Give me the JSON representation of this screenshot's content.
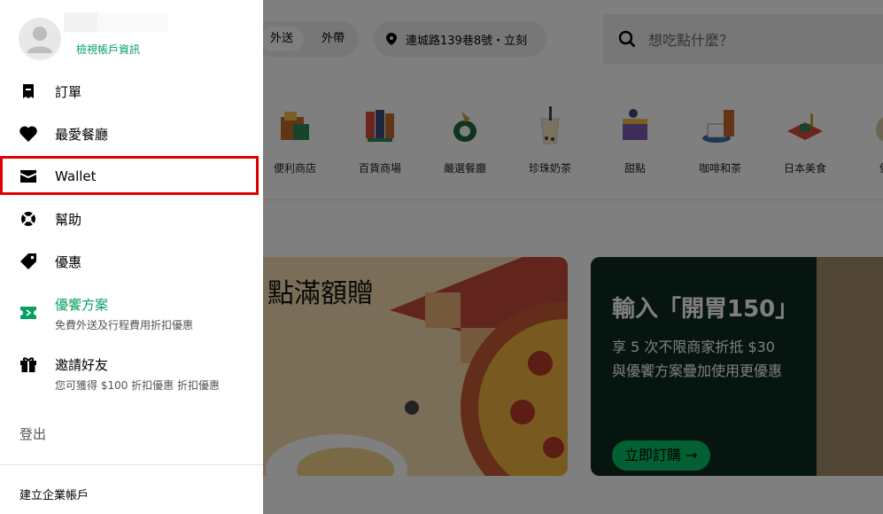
{
  "header": {
    "delivery_tab": "外送",
    "pickup_tab": "外帶",
    "location": "連城路139巷8號・立刻",
    "search_placeholder": "想吃點什麼？"
  },
  "categories": [
    {
      "label": "便利商店",
      "icon": "convenience-store-icon"
    },
    {
      "label": "百貨商場",
      "icon": "department-store-icon"
    },
    {
      "label": "嚴選餐廳",
      "icon": "restaurant-icon"
    },
    {
      "label": "珍珠奶茶",
      "icon": "bubble-tea-icon"
    },
    {
      "label": "甜點",
      "icon": "dessert-icon"
    },
    {
      "label": "咖啡和茶",
      "icon": "coffee-icon"
    },
    {
      "label": "日本美食",
      "icon": "japanese-food-icon"
    },
    {
      "label": "健康",
      "icon": "healthy-icon"
    }
  ],
  "promos": {
    "left_title": "點滿額贈",
    "right_title": "輸入「開胃150」",
    "right_line1": "享 5 次不限商家折抵 $30",
    "right_line2": "與優饗方案疊加使用更優惠",
    "right_button": "立即訂購 →"
  },
  "drawer": {
    "account_link": "檢視帳戶資訊",
    "menu": [
      {
        "label": "訂單",
        "icon": "receipt-icon"
      },
      {
        "label": "最愛餐廳",
        "icon": "heart-icon"
      },
      {
        "label": "Wallet",
        "icon": "wallet-icon"
      },
      {
        "label": "幫助",
        "icon": "lifebuoy-icon"
      },
      {
        "label": "優惠",
        "icon": "tag-icon"
      },
      {
        "label": "優饗方案",
        "sub": "免費外送及行程費用折扣優惠",
        "icon": "ticket-icon"
      },
      {
        "label": "邀請好友",
        "sub": "您可獲得 $100 折扣優惠 折扣優惠",
        "icon": "gift-icon"
      }
    ],
    "logout": "登出",
    "business": "建立企業帳戶"
  },
  "colors": {
    "accent_green": "#06a060",
    "highlight_red": "#e00000"
  }
}
